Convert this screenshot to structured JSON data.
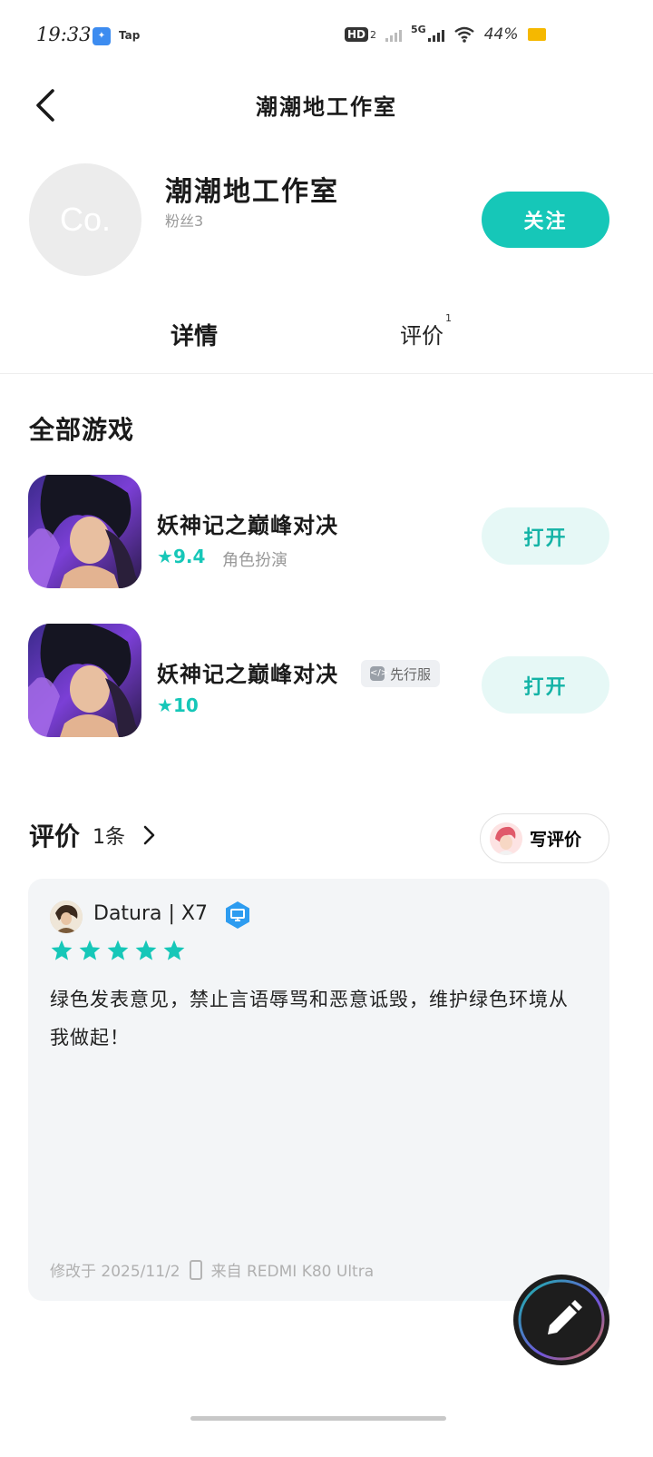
{
  "status_bar": {
    "time": "19:33",
    "app_icon_2": "Tap",
    "hd_label": "HD",
    "hd_sub": "2",
    "network_label": "5G",
    "battery_percent": "44%"
  },
  "nav": {
    "title": "潮潮地工作室"
  },
  "profile": {
    "avatar_text": "Co.",
    "name": "潮潮地工作室",
    "fans": "粉丝3",
    "follow_label": "关注"
  },
  "tabs": [
    {
      "label": "详情",
      "active": true
    },
    {
      "label": "评价",
      "count": "1",
      "active": false
    }
  ],
  "games_section": {
    "title": "全部游戏",
    "games": [
      {
        "name": "妖神记之巅峰对决",
        "rating": "9.4",
        "genre": "角色扮演",
        "action_label": "打开"
      },
      {
        "name": "妖神记之巅峰对决",
        "tag": "先行服",
        "rating": "10",
        "action_label": "打开"
      }
    ]
  },
  "reviews_section": {
    "title": "评价",
    "count": "1条",
    "write_label": "写评价",
    "review": {
      "username": "Datura | X7",
      "stars": 5,
      "text": "绿色发表意见，禁止言语辱骂和恶意诋毁，维护绿色环境从我做起！",
      "modified": "修改于 2025/11/2",
      "device": "来自 REDMI K80 Ultra"
    }
  },
  "colors": {
    "accent": "#16c7b8",
    "accent_light": "#e6f8f6",
    "card_bg": "#f3f5f7"
  }
}
